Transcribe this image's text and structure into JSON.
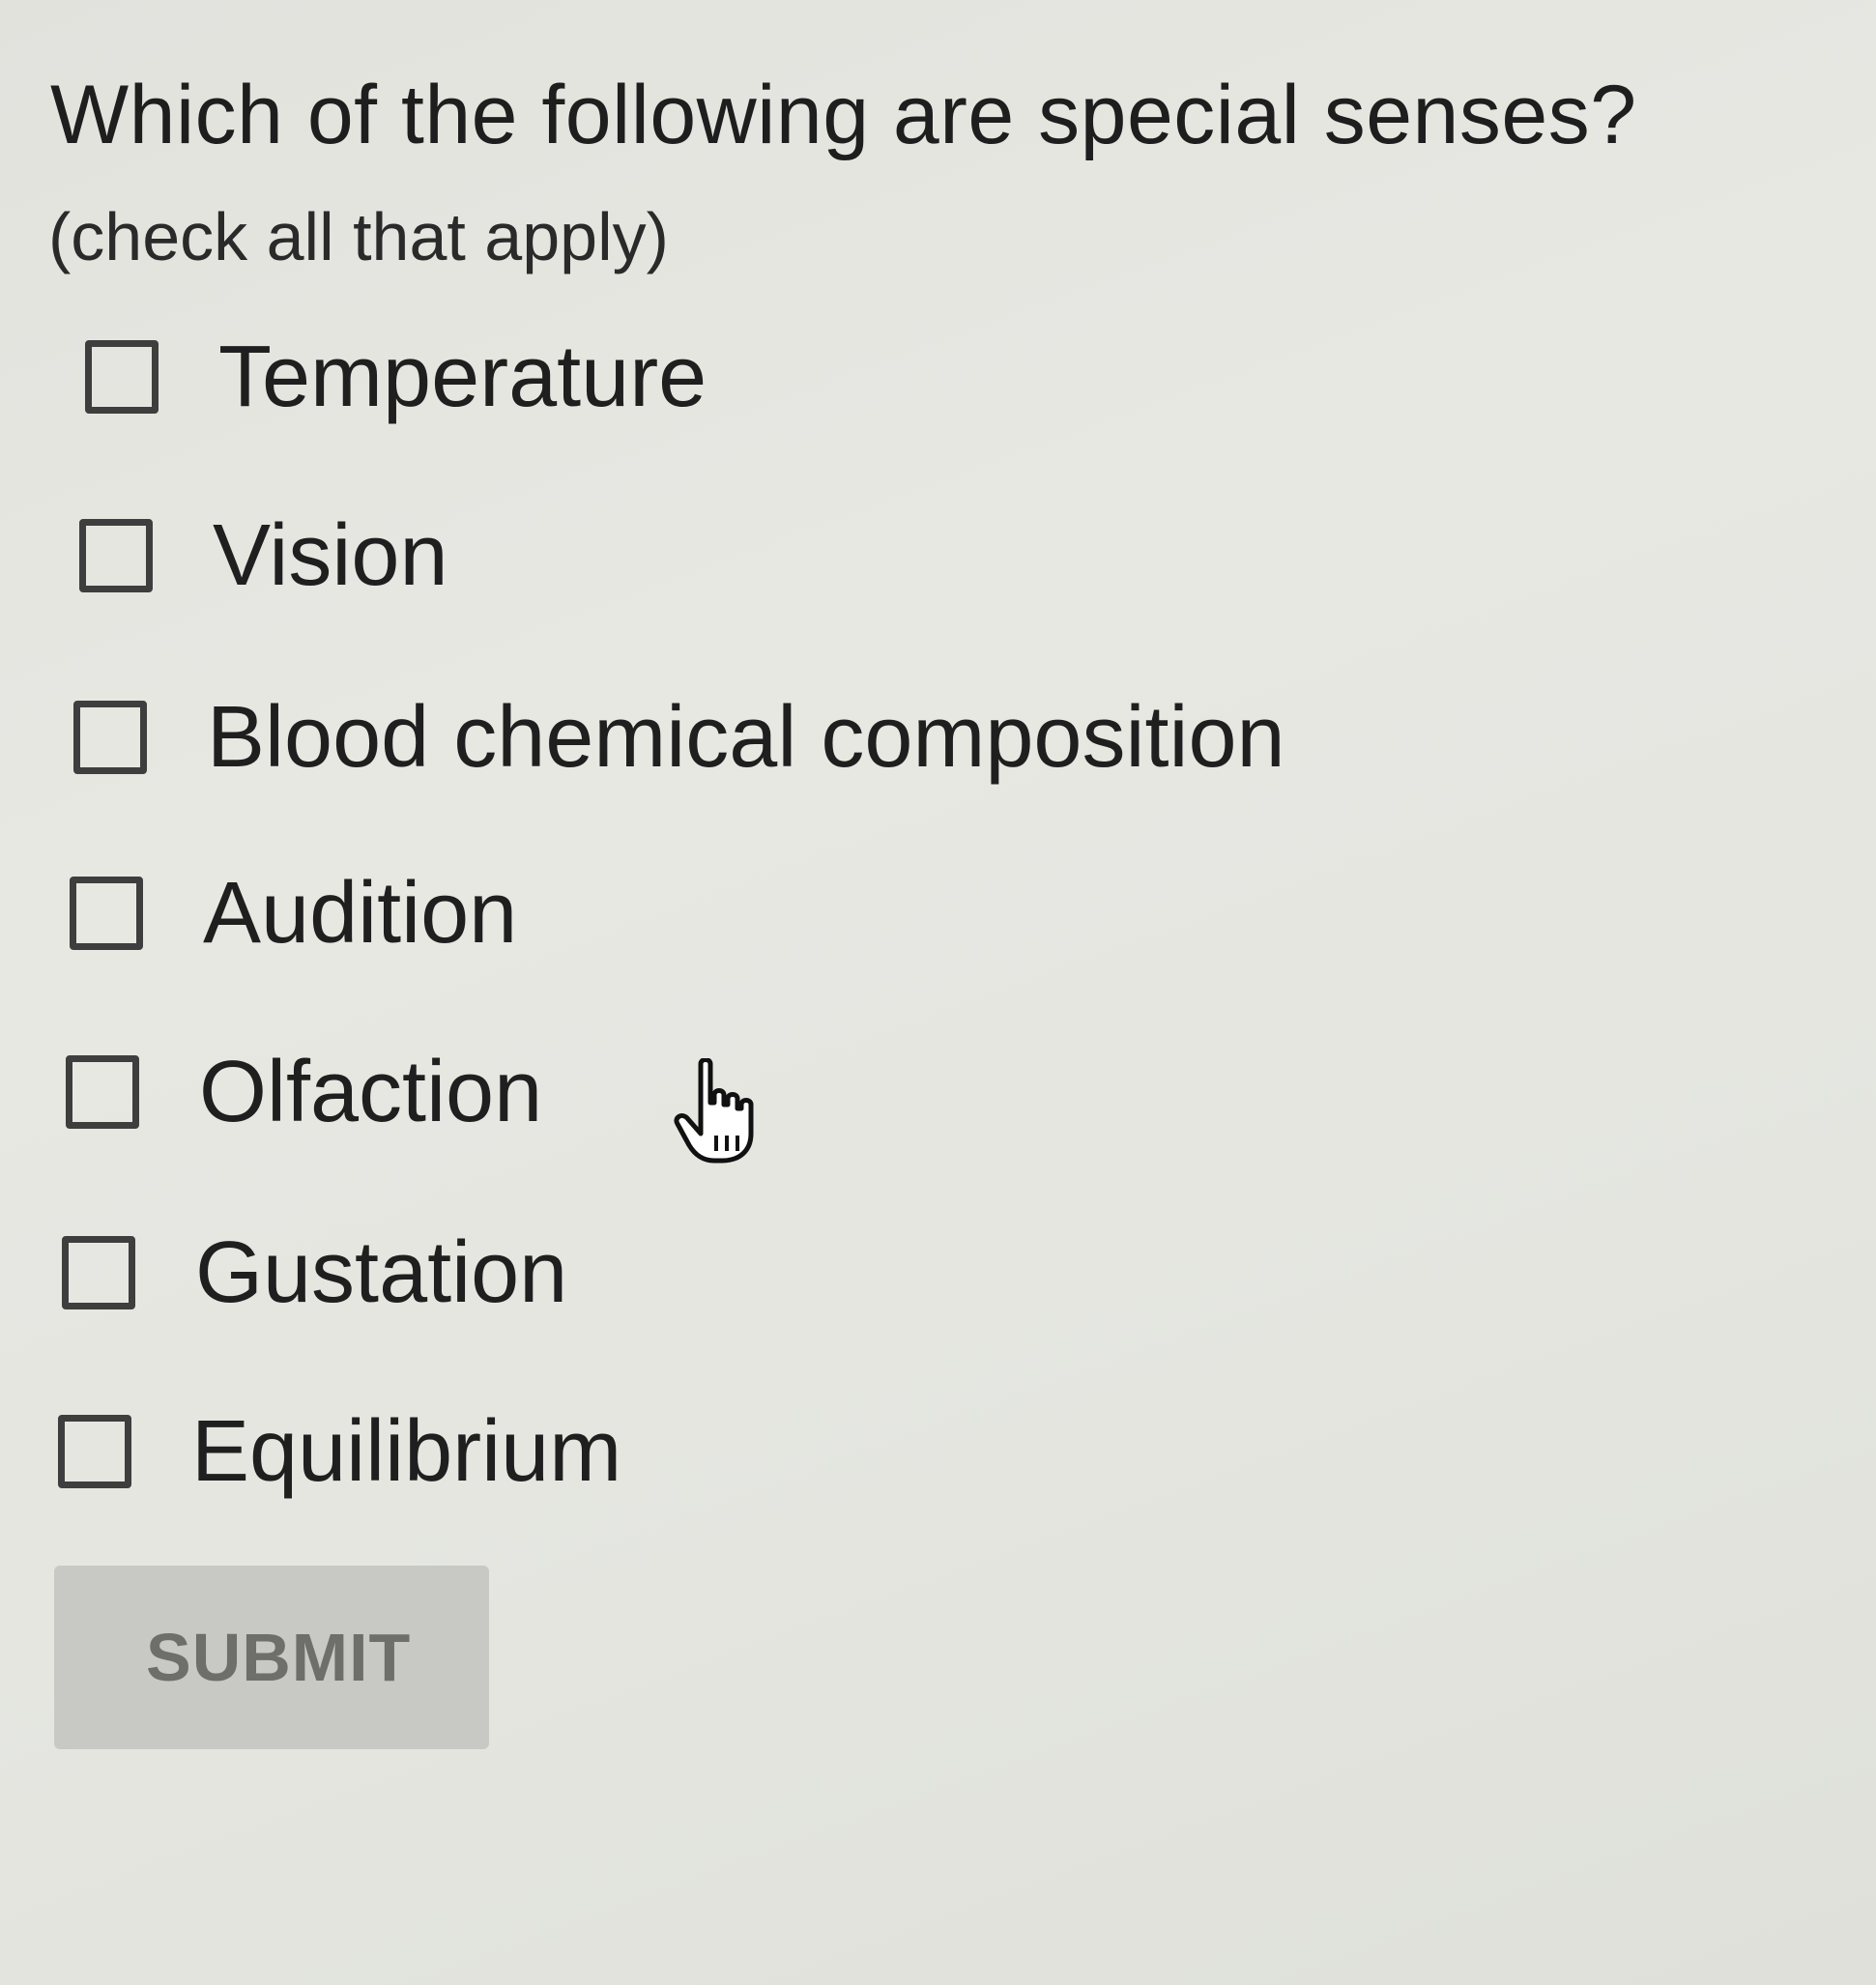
{
  "question": {
    "title": "Which of the following are special senses?",
    "instruction": "(check all that apply)"
  },
  "options": [
    {
      "label": "Temperature",
      "checked": false
    },
    {
      "label": "Vision",
      "checked": false
    },
    {
      "label": "Blood chemical composition",
      "checked": false
    },
    {
      "label": "Audition",
      "checked": false
    },
    {
      "label": "Olfaction",
      "checked": false
    },
    {
      "label": "Gustation",
      "checked": false
    },
    {
      "label": "Equilibrium",
      "checked": false
    }
  ],
  "submit": {
    "label": "SUBMIT",
    "disabled": true
  },
  "cursor": {
    "icon": "hand-pointer-icon"
  }
}
